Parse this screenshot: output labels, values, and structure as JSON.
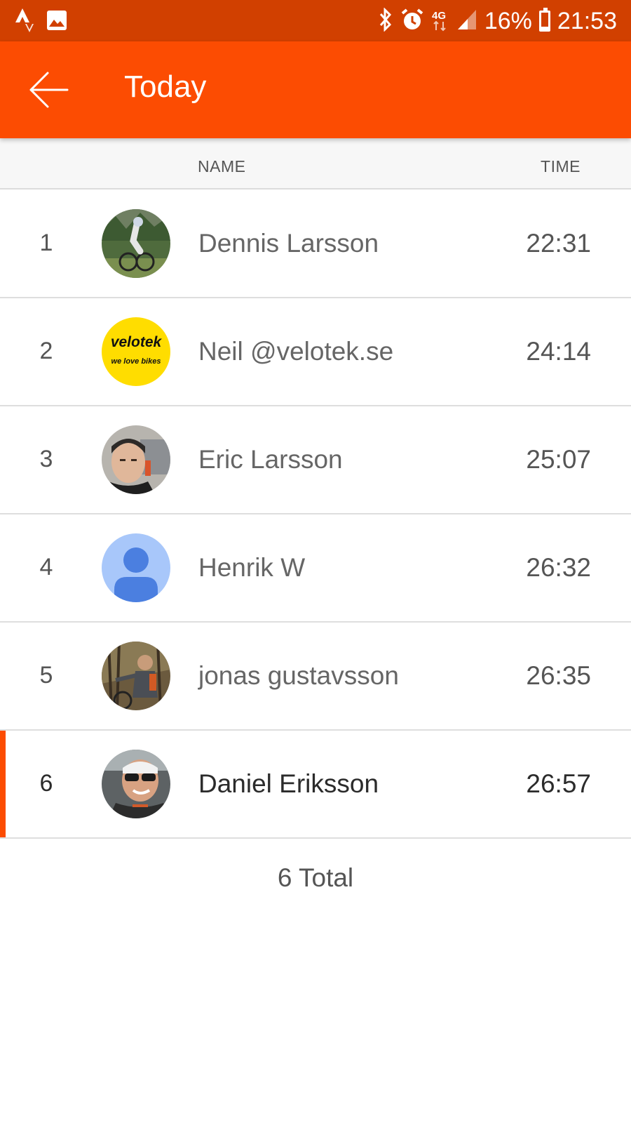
{
  "status_bar": {
    "left_icons": [
      "strava-icon",
      "image-icon"
    ],
    "right_icons": [
      "bluetooth-icon",
      "alarm-icon",
      "4g-icon",
      "signal-icon",
      "battery-icon"
    ],
    "network": "4G",
    "battery_percent": "16%",
    "battery_level": 0.16,
    "clock": "21:53"
  },
  "app_bar": {
    "title": "Today",
    "background_color": "#fc4c02",
    "status_color": "#d14000",
    "back_icon": "arrow-left-icon"
  },
  "table": {
    "columns": {
      "name": "NAME",
      "time": "TIME"
    },
    "rows": [
      {
        "rank": "1",
        "name": "Dennis Larsson",
        "time": "22:31",
        "avatar": "photo-mountain-biker"
      },
      {
        "rank": "2",
        "name": "Neil @velotek.se",
        "time": "24:14",
        "avatar": "velotek-logo"
      },
      {
        "rank": "3",
        "name": "Eric Larsson",
        "time": "25:07",
        "avatar": "photo-selfie"
      },
      {
        "rank": "4",
        "name": "Henrik W",
        "time": "26:32",
        "avatar": "default-person-icon"
      },
      {
        "rank": "5",
        "name": "jonas gustavsson",
        "time": "26:35",
        "avatar": "photo-forest-rider"
      },
      {
        "rank": "6",
        "name": "Daniel Eriksson",
        "time": "26:57",
        "avatar": "photo-sunglasses",
        "highlighted": true
      }
    ]
  },
  "logo": {
    "velotek_top": "velotek",
    "velotek_bottom": "we love bikes"
  },
  "footer": {
    "total": "6 Total"
  }
}
